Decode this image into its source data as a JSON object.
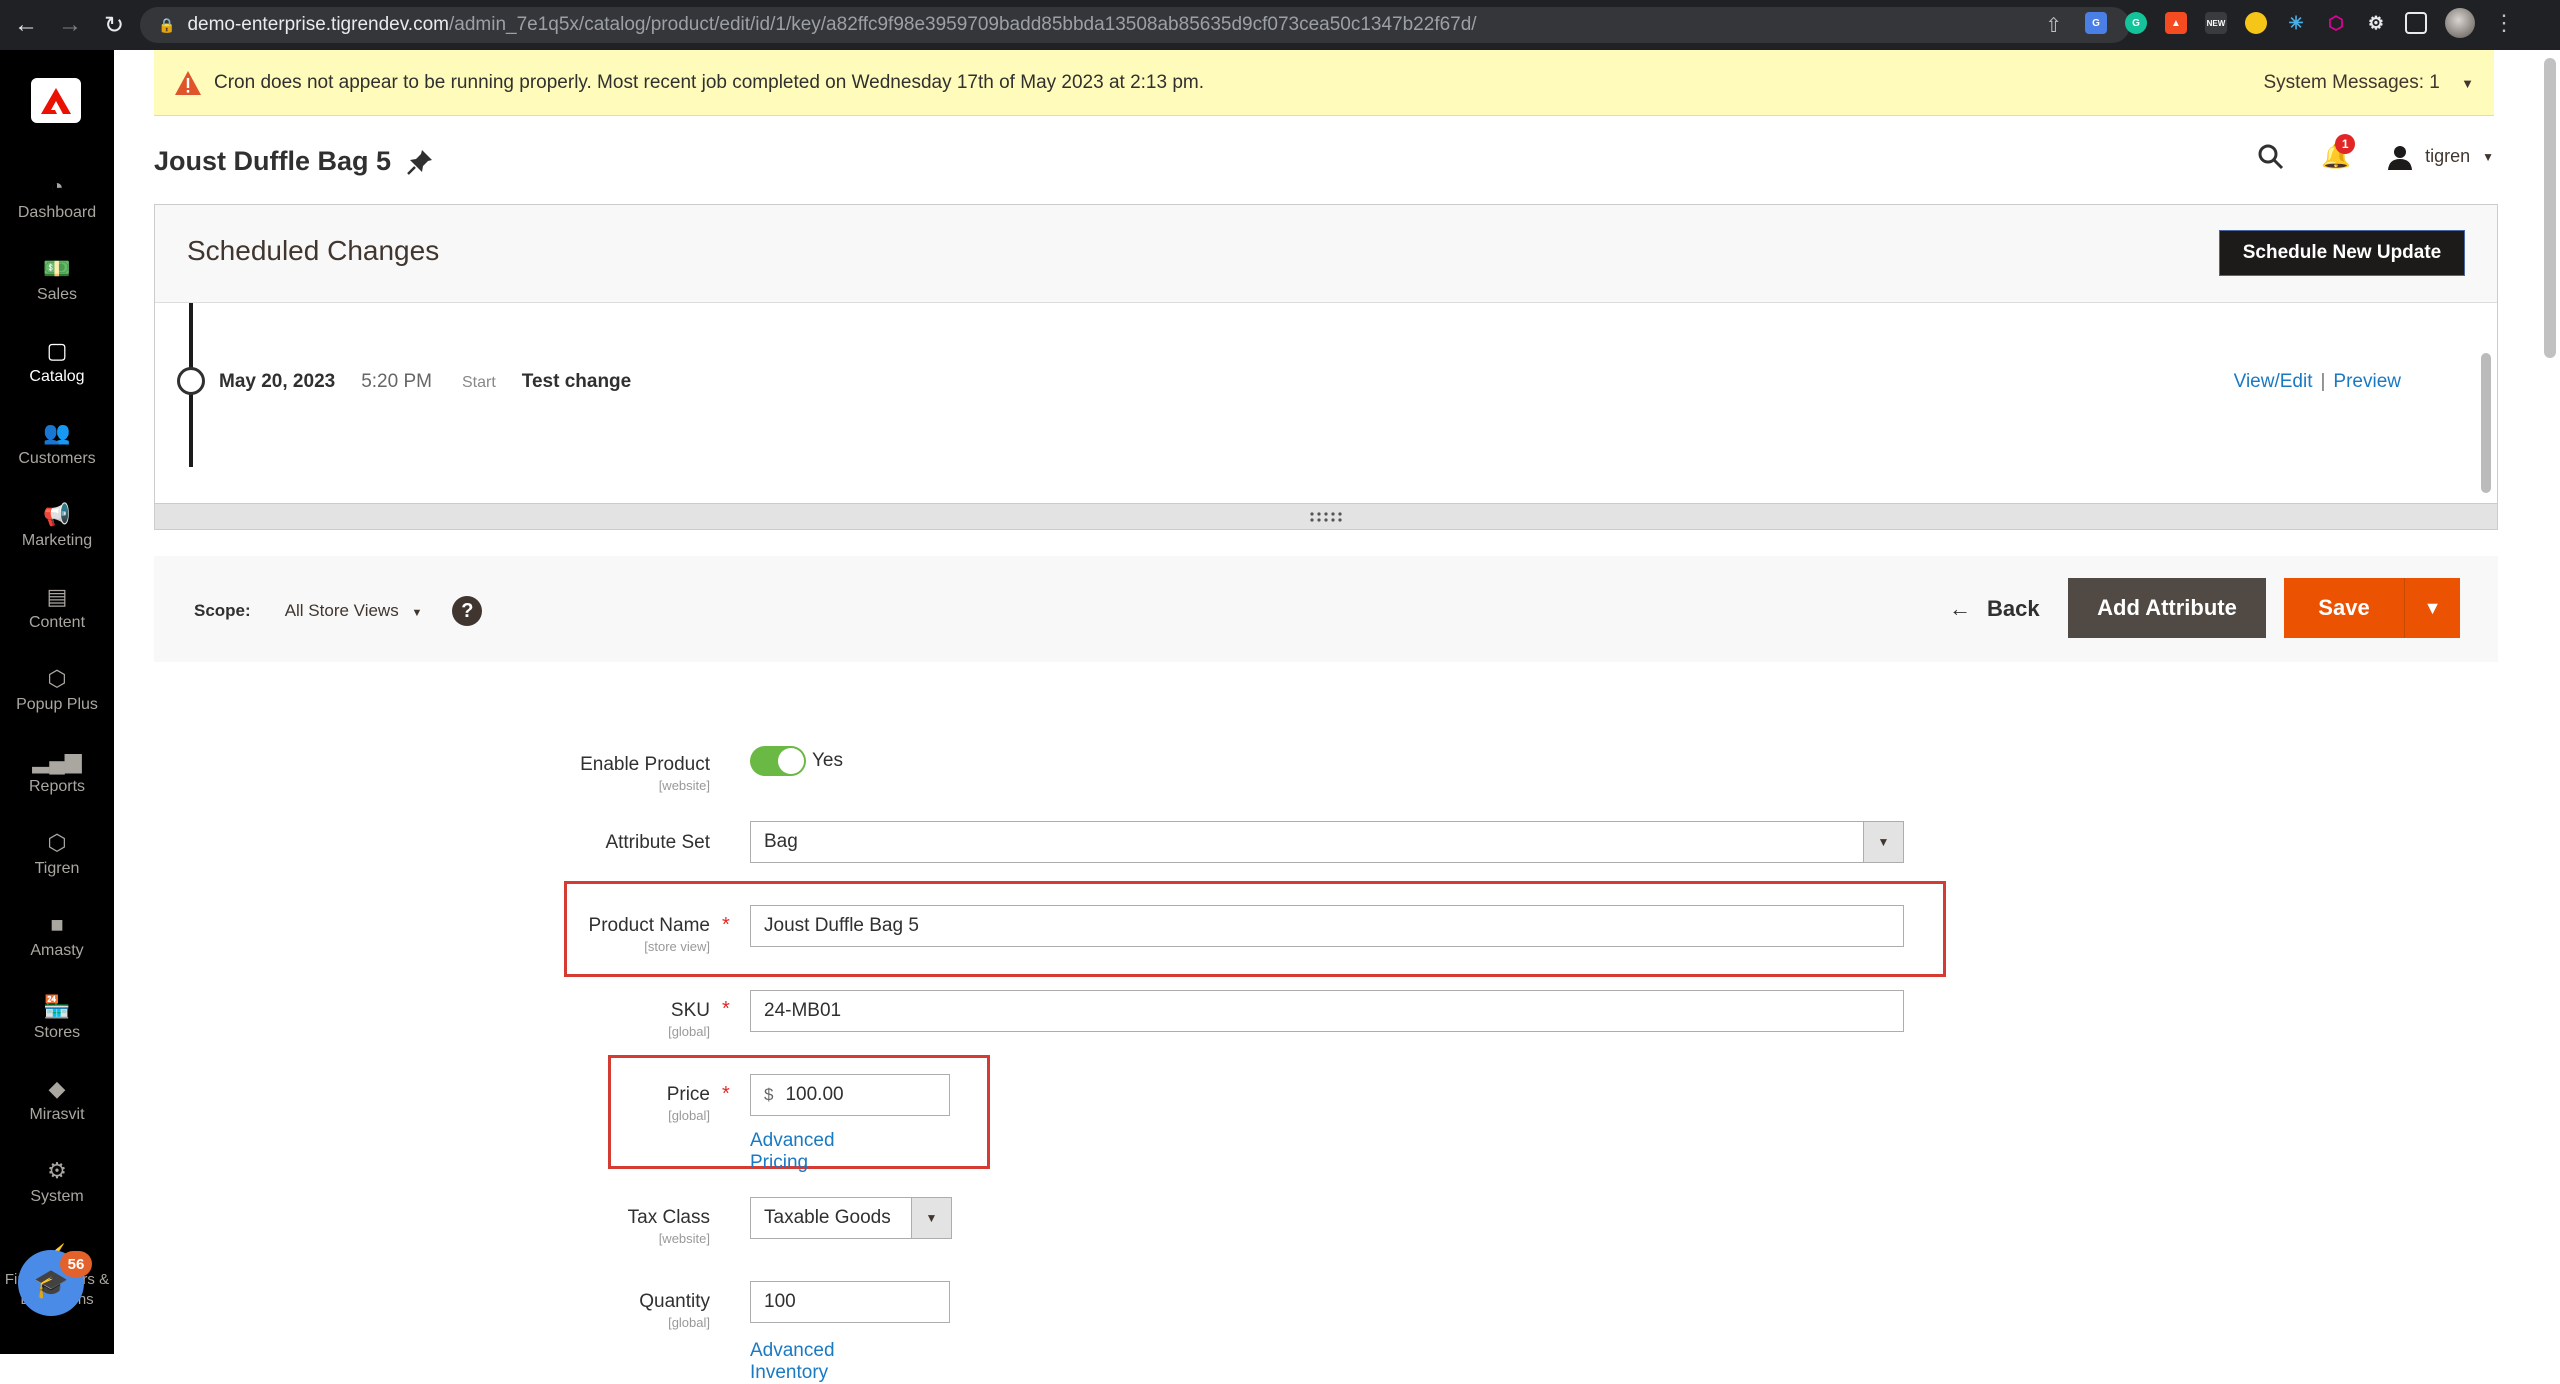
{
  "browser": {
    "url_host": "demo-enterprise.tigrendev.com",
    "url_path": "/admin_7e1q5x/catalog/product/edit/id/1/key/a82ffc9f98e3959709badd85bbda13508ab85635d9cf073cea50c1347b22f67d/",
    "extensions": [
      "google-translate",
      "grammarly",
      "lighthouse",
      "new-tab",
      "duck",
      "network",
      "graphql",
      "extensions",
      "side-panel"
    ]
  },
  "sidebar": {
    "items": [
      {
        "label": "Dashboard",
        "icon": "dashboard-icon"
      },
      {
        "label": "Sales",
        "icon": "sales-icon"
      },
      {
        "label": "Catalog",
        "icon": "catalog-icon",
        "active": true
      },
      {
        "label": "Customers",
        "icon": "customers-icon"
      },
      {
        "label": "Marketing",
        "icon": "marketing-icon"
      },
      {
        "label": "Content",
        "icon": "content-icon"
      },
      {
        "label": "Popup Plus",
        "icon": "hexagon-icon"
      },
      {
        "label": "Reports",
        "icon": "reports-icon"
      },
      {
        "label": "Tigren",
        "icon": "hexagon-icon"
      },
      {
        "label": "Amasty",
        "icon": "amasty-icon"
      },
      {
        "label": "Stores",
        "icon": "stores-icon"
      },
      {
        "label": "Mirasvit",
        "icon": "mirasvit-icon"
      },
      {
        "label": "System",
        "icon": "gear-icon"
      },
      {
        "label": "Find Partners & Extensions",
        "icon": "plug-icon"
      }
    ],
    "helper_badge": "56"
  },
  "system_message": {
    "text": "Cron does not appear to be running properly. Most recent job completed on Wednesday 17th of May 2023 at 2:13 pm.",
    "counter": "System Messages: 1"
  },
  "header": {
    "title": "Joust Duffle Bag 5",
    "notifications_count": "1",
    "username": "tigren"
  },
  "scheduled_changes": {
    "title": "Scheduled Changes",
    "schedule_button": "Schedule New Update",
    "items": [
      {
        "date": "May 20, 2023",
        "time": "5:20 PM",
        "type": "Start",
        "name": "Test change",
        "view_edit": "View/Edit",
        "preview": "Preview"
      }
    ]
  },
  "actions": {
    "scope_label": "Scope:",
    "scope_value": "All Store Views",
    "back": "Back",
    "add_attribute": "Add Attribute",
    "save": "Save"
  },
  "form": {
    "enable_product": {
      "label": "Enable Product",
      "scope": "[website]",
      "value": "Yes",
      "enabled": true
    },
    "attribute_set": {
      "label": "Attribute Set",
      "value": "Bag"
    },
    "product_name": {
      "label": "Product Name",
      "scope": "[store view]",
      "value": "Joust Duffle Bag 5"
    },
    "sku": {
      "label": "SKU",
      "scope": "[global]",
      "value": "24-MB01"
    },
    "price": {
      "label": "Price",
      "scope": "[global]",
      "currency": "$",
      "value": "100.00",
      "link": "Advanced Pricing"
    },
    "tax_class": {
      "label": "Tax Class",
      "scope": "[website]",
      "value": "Taxable Goods"
    },
    "quantity": {
      "label": "Quantity",
      "scope": "[global]",
      "value": "100",
      "link": "Advanced Inventory"
    }
  },
  "colors": {
    "accent": "#eb5202",
    "link": "#1979c3",
    "toggle_on": "#6ab945",
    "highlight": "#d33b33",
    "warning_bg": "#fffbbb"
  }
}
